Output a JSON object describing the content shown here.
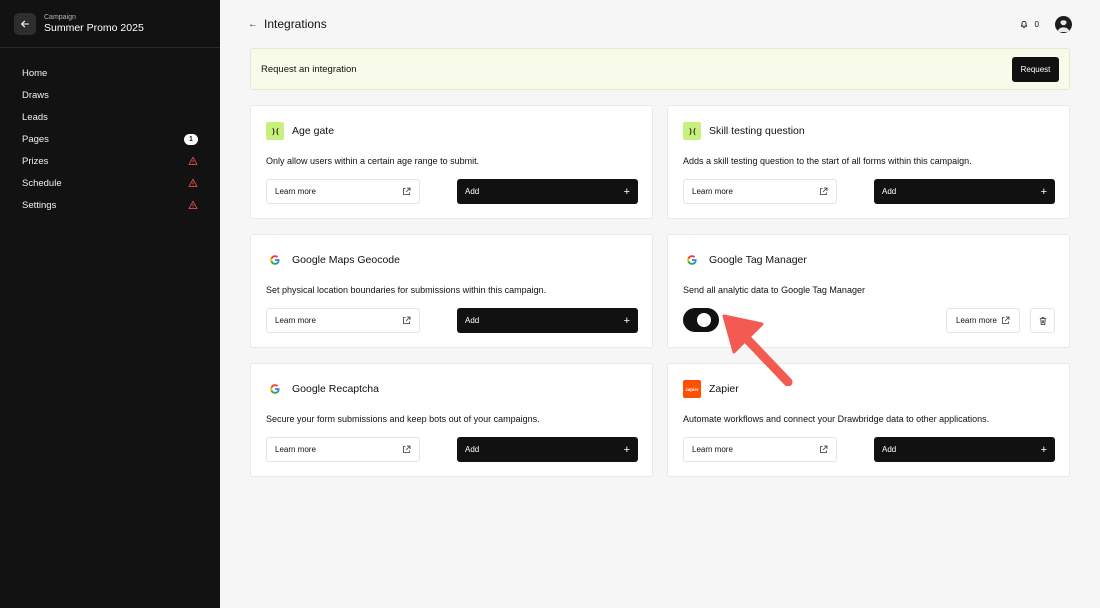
{
  "sidebar": {
    "eyebrow": "Campaign",
    "campaign_name": "Summer Promo 2025",
    "items": [
      {
        "label": "Home"
      },
      {
        "label": "Draws"
      },
      {
        "label": "Leads"
      },
      {
        "label": "Pages",
        "badge": "1"
      },
      {
        "label": "Prizes",
        "status": "warning"
      },
      {
        "label": "Schedule",
        "status": "warning"
      },
      {
        "label": "Settings",
        "status": "warning"
      }
    ]
  },
  "header": {
    "title": "Integrations",
    "notification_count": "0"
  },
  "banner": {
    "text": "Request an integration",
    "button": "Request"
  },
  "cards": [
    {
      "title": "Age gate",
      "logo": "drawbridge-logo",
      "description": "Only allow users within a certain age range to submit.",
      "learn_more": "Learn more",
      "add": "Add"
    },
    {
      "title": "Skill testing question",
      "logo": "drawbridge-logo",
      "description": "Adds a skill testing question to the start of all forms within this campaign.",
      "learn_more": "Learn more",
      "add": "Add"
    },
    {
      "title": "Google Maps Geocode",
      "logo": "google-logo",
      "description": "Set physical location boundaries for submissions within this campaign.",
      "learn_more": "Learn more",
      "add": "Add"
    },
    {
      "title": "Google Tag Manager",
      "logo": "google-logo",
      "description": "Send all analytic data to Google Tag Manager",
      "learn_more": "Learn more",
      "enabled": true
    },
    {
      "title": "Google Recaptcha",
      "logo": "google-logo",
      "description": "Secure your form submissions and keep bots out of your campaigns.",
      "learn_more": "Learn more",
      "add": "Add"
    },
    {
      "title": "Zapier",
      "logo": "zapier-logo",
      "logo_text": "zapier",
      "description": "Automate workflows and connect your Drawbridge data to other applications.",
      "learn_more": "Learn more",
      "add": "Add"
    }
  ],
  "colors": {
    "sidebar_bg": "#121212",
    "accent_green": "#c9ef7f",
    "warning": "#e5484d",
    "annotation_arrow": "#f25a52"
  }
}
